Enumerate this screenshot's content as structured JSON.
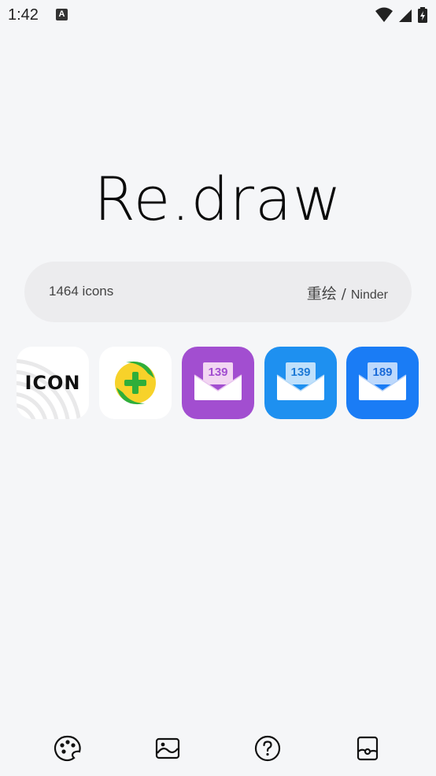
{
  "status_bar": {
    "time": "1:42",
    "notification_glyph": "A",
    "icons": [
      "wifi-icon",
      "signal-icon",
      "battery-charging-icon"
    ]
  },
  "app": {
    "logo_text": "Re.draw"
  },
  "info": {
    "icon_count": "1464 icons",
    "credit_cn": "重绘",
    "credit_sep": "/",
    "credit_en": "Ninder"
  },
  "featured_icons": [
    {
      "name": "icon-app",
      "label": "ICON",
      "bg": "#ffffff"
    },
    {
      "name": "360-plus-app",
      "bg": "#ffffff",
      "accent": "#f7d22a",
      "ring": "#2fae3a"
    },
    {
      "name": "139-mail-purple",
      "label": "139",
      "bg": "#a24ed0"
    },
    {
      "name": "139-mail-blue",
      "label": "139",
      "bg": "#1e90f0"
    },
    {
      "name": "189-mail",
      "label": "189",
      "bg": "#1a7cf5"
    }
  ],
  "bottom_nav": [
    "palette-icon",
    "wallpaper-icon",
    "help-icon",
    "widget-icon"
  ]
}
